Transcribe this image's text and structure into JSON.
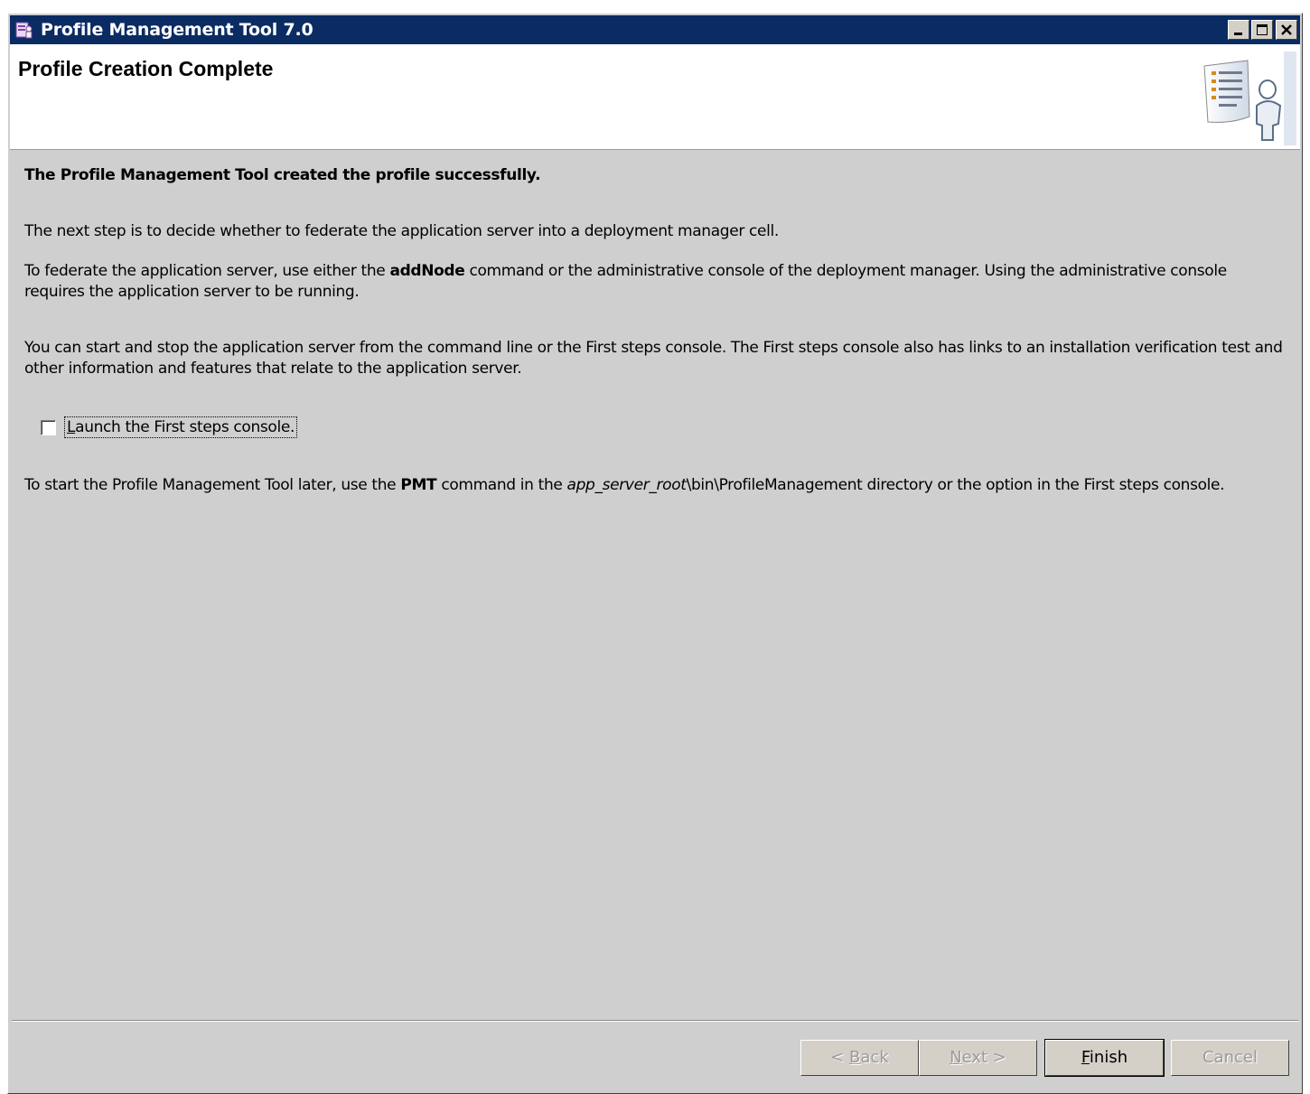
{
  "window": {
    "title": "Profile Management Tool 7.0"
  },
  "header": {
    "title": "Profile Creation Complete"
  },
  "content": {
    "headline": "The Profile Management Tool created the profile successfully.",
    "para1": "The next step is to decide whether to federate the application server into a deployment manager cell.",
    "para2_pre": "To federate the application server, use either the ",
    "para2_bold": "addNode",
    "para2_post": " command or the administrative console of the deployment manager. Using the administrative console requires the application server to be running.",
    "para3": "You can start and stop the application server from the command line or the First steps console. The First steps console also has links to an installation verification test and other information and features that relate to the application server.",
    "checkbox_label_mnemonic": "L",
    "checkbox_label_rest": "aunch the First steps console.",
    "checkbox_checked": false,
    "para4_pre": "To start the Profile Management Tool later, use the ",
    "para4_bold": "PMT",
    "para4_mid": " command in the ",
    "para4_italic": "app_server_root",
    "para4_post": "\\bin\\ProfileManagement directory or the option in the First steps console."
  },
  "buttons": {
    "back_pre": "< ",
    "back_mnemonic": "B",
    "back_rest": "ack",
    "next_mnemonic": "N",
    "next_rest": "ext >",
    "finish_mnemonic": "F",
    "finish_rest": "inish",
    "cancel": "Cancel"
  },
  "icons": {
    "app": "profile-tool-icon",
    "header_graphic": "checklist-person-icon",
    "minimize": "minimize-icon",
    "maximize": "maximize-icon",
    "close": "close-icon"
  }
}
